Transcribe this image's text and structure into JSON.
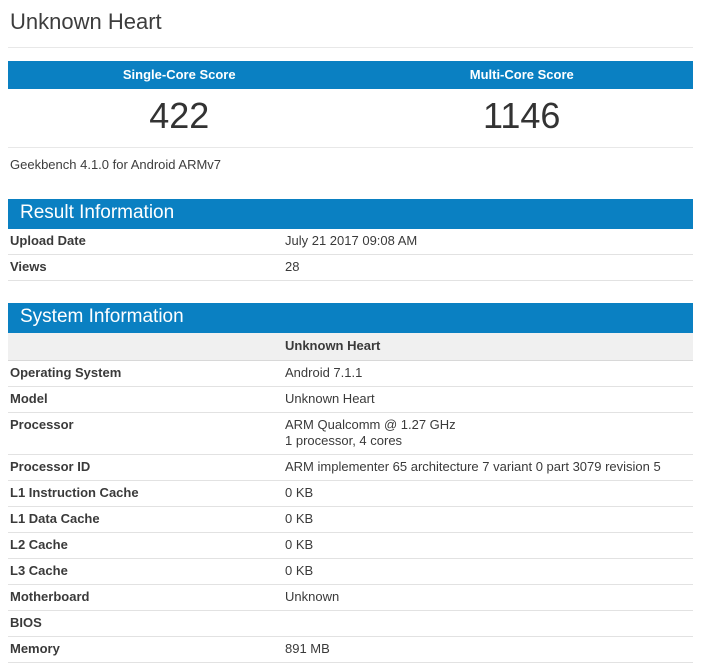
{
  "page": {
    "title": "Unknown Heart",
    "subtitle": "Geekbench 4.1.0 for Android ARMv7"
  },
  "colors": {
    "accent_blue": "#0a80c2",
    "header_text": "#ffffff",
    "body_text": "#3a3a3a"
  },
  "scores": {
    "single_core_label": "Single-Core Score",
    "single_core_value": "422",
    "multi_core_label": "Multi-Core Score",
    "multi_core_value": "1146"
  },
  "result_information": {
    "title": "Result Information",
    "rows": [
      {
        "label": "Upload Date",
        "value": "July 21 2017 09:08 AM"
      },
      {
        "label": "Views",
        "value": "28"
      }
    ]
  },
  "system_information": {
    "title": "System Information",
    "subheader": "Unknown Heart",
    "rows": [
      {
        "label": "Operating System",
        "value": "Android 7.1.1"
      },
      {
        "label": "Model",
        "value": "Unknown Heart"
      },
      {
        "label": "Processor",
        "value": "ARM Qualcomm @ 1.27 GHz\n1 processor, 4 cores"
      },
      {
        "label": "Processor ID",
        "value": "ARM implementer 65 architecture 7 variant 0 part 3079 revision 5"
      },
      {
        "label": "L1 Instruction Cache",
        "value": "0 KB"
      },
      {
        "label": "L1 Data Cache",
        "value": "0 KB"
      },
      {
        "label": "L2 Cache",
        "value": "0 KB"
      },
      {
        "label": "L3 Cache",
        "value": "0 KB"
      },
      {
        "label": "Motherboard",
        "value": "Unknown"
      },
      {
        "label": "BIOS",
        "value": ""
      },
      {
        "label": "Memory",
        "value": "891 MB"
      }
    ]
  }
}
